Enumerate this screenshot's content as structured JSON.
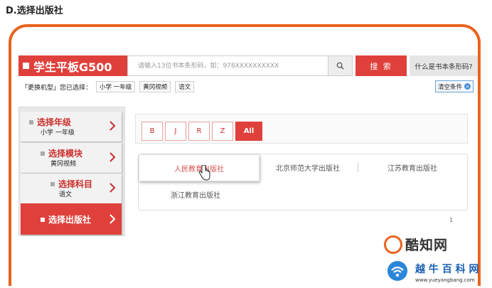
{
  "caption": "D.选择出版社",
  "header": {
    "brand": "学生平板G500",
    "search_placeholder": "请输入13位书本条形码，如：978XXXXXXXXXX",
    "search_button": "搜 索",
    "whatis_button": "什么是书本条形码?"
  },
  "selection": {
    "prefix": "「更换机型」您已选择：",
    "chips": [
      "小学 一年级",
      "黄冈视频",
      "语文"
    ],
    "clear": "清空条件"
  },
  "sidebar": {
    "steps": [
      {
        "title": "选择年级",
        "sub": "小学 一年级"
      },
      {
        "title": "选择模块",
        "sub": "黄冈视频"
      },
      {
        "title": "选择科目",
        "sub": "语文"
      },
      {
        "title": "选择出版社",
        "sub": ""
      }
    ]
  },
  "letters": [
    "B",
    "J",
    "R",
    "Z",
    "All"
  ],
  "active_letter": "All",
  "publishers": [
    "人民教育出版社",
    "北京师范大学出版社",
    "江苏教育出版社",
    "浙江教育出版社"
  ],
  "selected_publisher": "人民教育出版社",
  "page_number": "1",
  "watermarks": {
    "logo1": "酷知网",
    "logo2_name": "越 牛 百 科 网",
    "logo2_url": "www.yueyangbang.com"
  },
  "colors": {
    "accent": "#e0403b",
    "frame": "#e8641e"
  }
}
